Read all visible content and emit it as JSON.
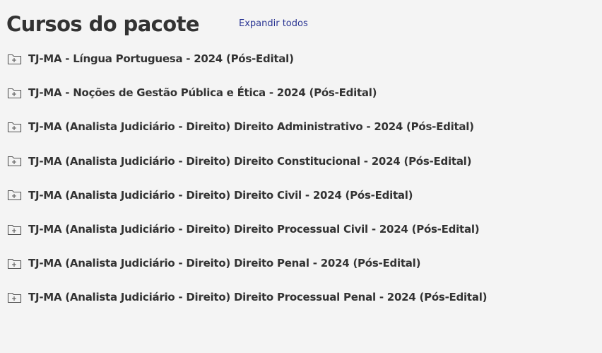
{
  "header": {
    "title": "Cursos do pacote",
    "expand_all_label": "Expandir todos"
  },
  "icons": {
    "course_folder": "folder-plus-icon"
  },
  "colors": {
    "text": "#333333",
    "link": "#2a3593",
    "background": "#f4f4f4"
  },
  "courses": [
    {
      "label": "TJ-MA - Língua Portuguesa - 2024 (Pós-Edital)"
    },
    {
      "label": "TJ-MA - Noções de Gestão Pública e Ética - 2024 (Pós-Edital)"
    },
    {
      "label": "TJ-MA (Analista Judiciário - Direito) Direito Administrativo - 2024 (Pós-Edital)"
    },
    {
      "label": "TJ-MA (Analista Judiciário - Direito) Direito Constitucional - 2024 (Pós-Edital)"
    },
    {
      "label": "TJ-MA (Analista Judiciário - Direito) Direito Civil - 2024 (Pós-Edital)"
    },
    {
      "label": "TJ-MA (Analista Judiciário - Direito) Direito Processual Civil - 2024 (Pós-Edital)"
    },
    {
      "label": "TJ-MA (Analista Judiciário - Direito) Direito Penal - 2024 (Pós-Edital)"
    },
    {
      "label": "TJ-MA (Analista Judiciário - Direito) Direito Processual Penal - 2024 (Pós-Edital)"
    }
  ]
}
